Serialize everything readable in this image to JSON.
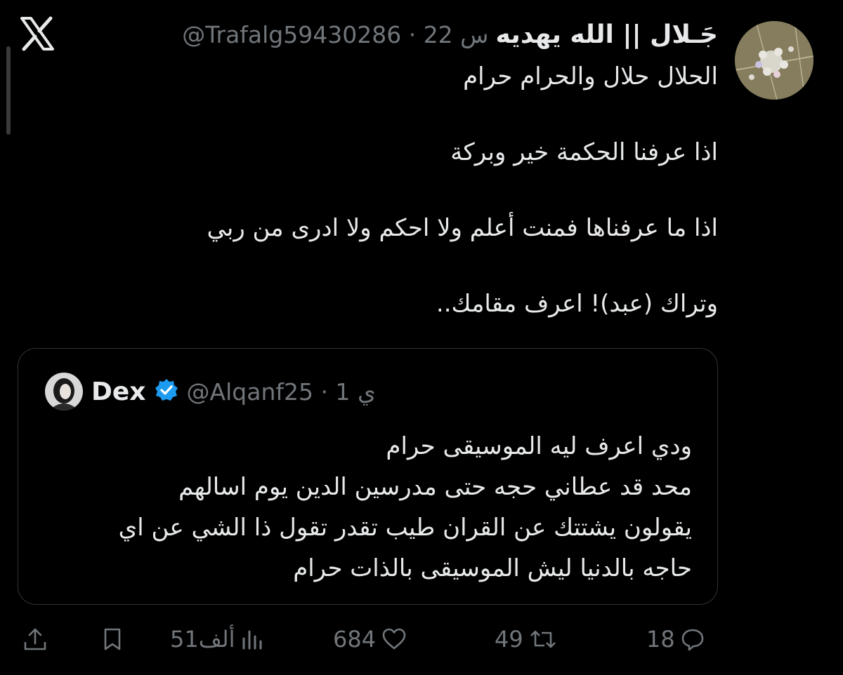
{
  "app": {
    "scrollbar": "vertical-scrollbar"
  },
  "tweet": {
    "author_name": "جَـلال || الله يهديه",
    "meta": "@Trafalg59430286 · 22 س",
    "body": [
      "الحلال حلال والحرام حرام",
      "",
      "اذا عرفنا الحكمة خير وبركة",
      "",
      "اذا ما عرفناها فمنت أعلم ولا احكم ولا ادرى من ربي",
      "",
      "وتراك (عبد)! اعرف مقامك.."
    ]
  },
  "quote": {
    "author_name": "Dex",
    "verified": true,
    "meta": "@Alqanf25 · 1 ي",
    "body": [
      "ودي اعرف ليه الموسيقى حرام",
      "محد قد عطاني حجه حتى مدرسين الدين يوم اسالهم",
      "يقولون يشتتك عن القران طيب تقدر تقول ذا الشي عن اي",
      "حاجه بالدنيا ليش الموسيقى بالذات حرام"
    ]
  },
  "actions": {
    "replies": "18",
    "reposts": "49",
    "likes": "684",
    "views": "51ألف"
  },
  "icons": [
    "x-logo-icon",
    "reply-icon",
    "repost-icon",
    "like-icon",
    "views-icon",
    "bookmark-icon",
    "share-icon",
    "verified-badge-icon"
  ],
  "colors": {
    "background": "#000000",
    "text": "#e7e9ea",
    "secondary": "#71767b",
    "verified": "#1d9bf0",
    "border": "#2f3336"
  }
}
